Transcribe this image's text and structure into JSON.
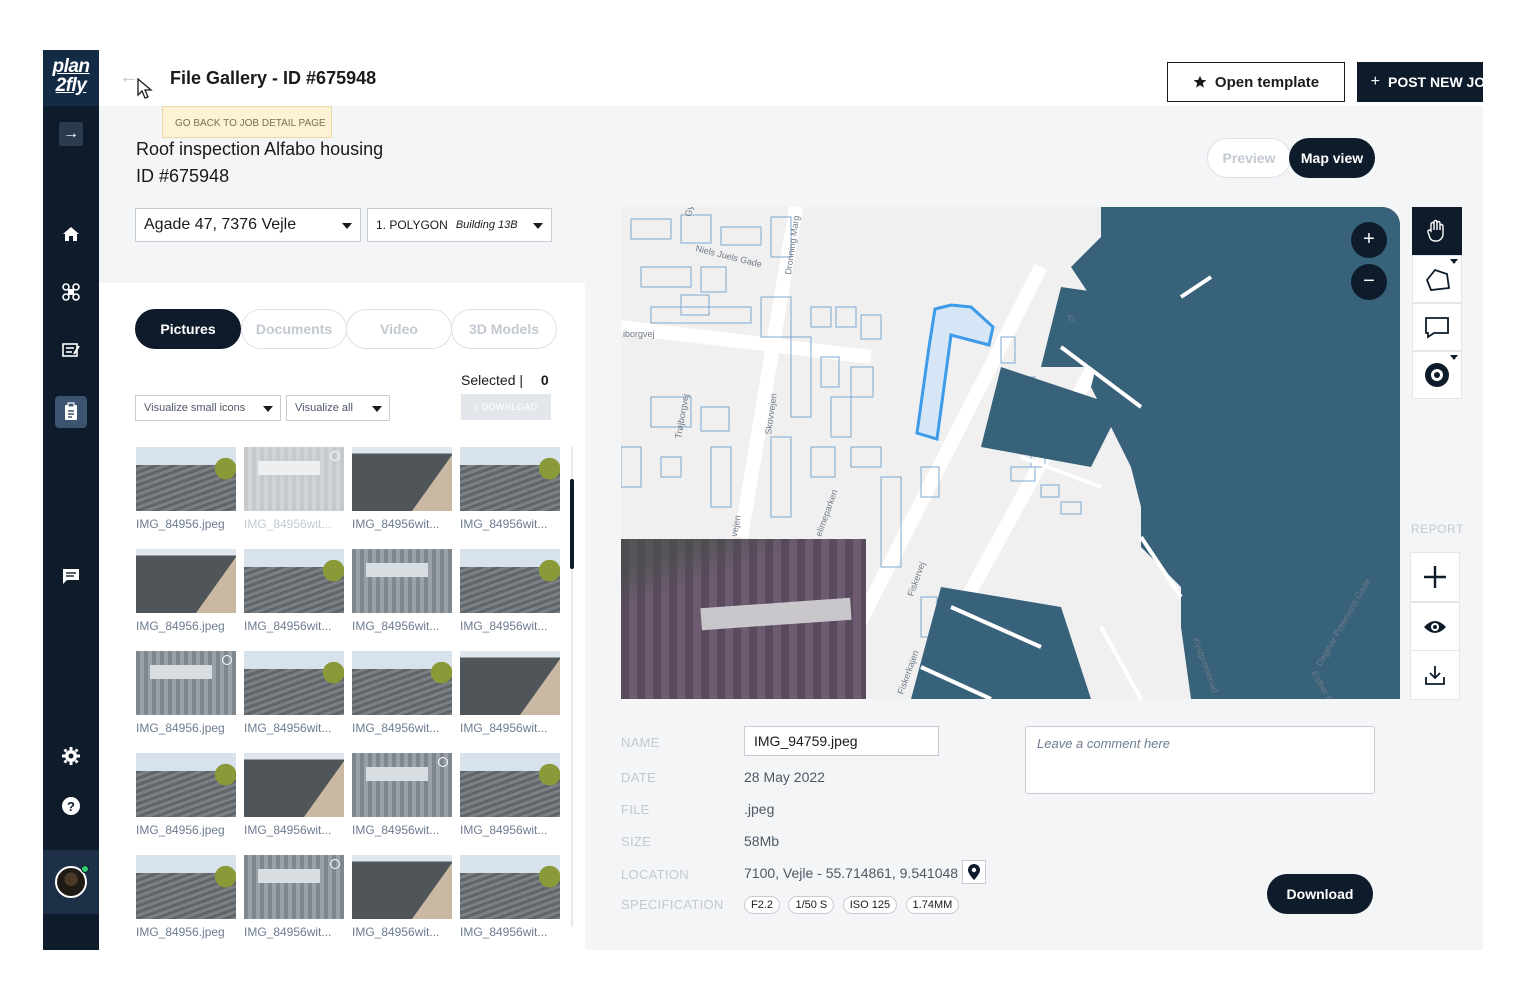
{
  "app": {
    "logo_line1": "plan",
    "logo_line2": "2fly"
  },
  "header": {
    "title": "File Gallery - ID #675948",
    "tooltip": "GO BACK TO JOB DETAIL PAGE",
    "open_template": "Open template",
    "post_new_job": "POST NEW JOB"
  },
  "job": {
    "title": "Roof inspection Alfabo housing",
    "id": "ID #675948",
    "address": "Agade 47, 7376 Vejle",
    "polygon_label": "1. POLYGON",
    "polygon_building": "Building 13B"
  },
  "gallery": {
    "tabs": [
      "Pictures",
      "Documents",
      "Video",
      "3D Models"
    ],
    "active_tab": "Pictures",
    "selected_label": "Selected",
    "selected_count": "0",
    "visualize_size": "Visualize small icons",
    "visualize_filter": "Visualize all",
    "download_label": "DOWNLOAD",
    "thumbnails": [
      {
        "name": "IMG_84956.jpeg",
        "type": "sky",
        "faded": false,
        "circle": false
      },
      {
        "name": "IMG_84956wit...",
        "type": "aerial",
        "faded": true,
        "circle": true
      },
      {
        "name": "IMG_84956wit...",
        "type": "gable",
        "faded": false,
        "circle": false
      },
      {
        "name": "IMG_84956wit...",
        "type": "sky",
        "faded": false,
        "circle": false
      },
      {
        "name": "IMG_84956.jpeg",
        "type": "gable",
        "faded": false,
        "circle": false
      },
      {
        "name": "IMG_84956wit...",
        "type": "sky",
        "faded": false,
        "circle": false
      },
      {
        "name": "IMG_84956wit...",
        "type": "aerial",
        "faded": false,
        "circle": false
      },
      {
        "name": "IMG_84956wit...",
        "type": "sky",
        "faded": false,
        "circle": false
      },
      {
        "name": "IMG_84956.jpeg",
        "type": "aerial",
        "faded": false,
        "circle": true
      },
      {
        "name": "IMG_84956wit...",
        "type": "sky",
        "faded": false,
        "circle": false
      },
      {
        "name": "IMG_84956wit...",
        "type": "sky",
        "faded": false,
        "circle": false
      },
      {
        "name": "IMG_84956wit...",
        "type": "gable",
        "faded": false,
        "circle": false
      },
      {
        "name": "IMG_84956.jpeg",
        "type": "sky",
        "faded": false,
        "circle": false
      },
      {
        "name": "IMG_84956wit...",
        "type": "gable",
        "faded": false,
        "circle": false
      },
      {
        "name": "IMG_84956wit...",
        "type": "aerial",
        "faded": false,
        "circle": true
      },
      {
        "name": "IMG_84956wit...",
        "type": "sky",
        "faded": false,
        "circle": false
      },
      {
        "name": "IMG_84956.jpeg",
        "type": "sky",
        "faded": false,
        "circle": false
      },
      {
        "name": "IMG_84956wit...",
        "type": "aerial",
        "faded": false,
        "circle": true
      },
      {
        "name": "IMG_84956wit...",
        "type": "gable",
        "faded": false,
        "circle": false
      },
      {
        "name": "IMG_84956wit...",
        "type": "sky",
        "faded": false,
        "circle": false
      }
    ]
  },
  "view_toggle": {
    "preview": "Preview",
    "map_view": "Map view",
    "active": "Map view"
  },
  "map": {
    "street_labels": [
      "Niels Juels Gade",
      "Dronning Marg",
      "Skovvejen",
      "Trøjborgvej",
      "iborgvej",
      "Fiskervej",
      "Kystpromenad",
      "Dagmar Petersens Gade",
      "Esther A",
      "Tr",
      "Gyl",
      "elimeparken",
      "Fiskerkajen",
      "vejen"
    ],
    "zoom_in": "+",
    "zoom_out": "−"
  },
  "tools": {
    "report_label": "REPORT",
    "items": [
      "hand-icon",
      "polygon-icon",
      "comment-icon",
      "target-icon"
    ],
    "report_items": [
      "plus-icon",
      "eye-icon",
      "download-icon"
    ]
  },
  "details": {
    "labels": {
      "name": "NAME",
      "date": "DATE",
      "file": "FILE",
      "size": "SIZE",
      "location": "LOCATION",
      "specification": "SPECIFICATION"
    },
    "name_value": "IMG_94759.jpeg",
    "date_value": "28 May 2022",
    "file_value": ".jpeg",
    "size_value": "58Mb",
    "location_value": "7100, Vejle - 55.714861, 9.541048",
    "spec_chips": [
      "F2.2",
      "1/50 S",
      "ISO 125",
      "1.74MM"
    ],
    "comment_placeholder": "Leave a comment here",
    "download_button": "Download"
  },
  "colors": {
    "navy": "#0d1b2a",
    "water": "#37627a",
    "polygon": "#3d9be9"
  }
}
